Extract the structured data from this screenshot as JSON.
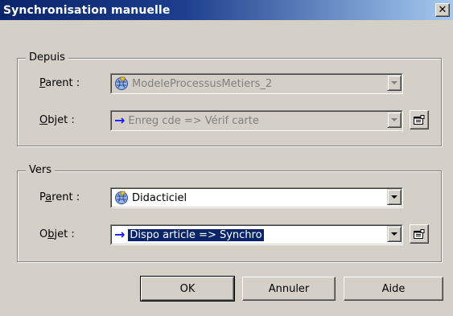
{
  "window": {
    "title": "Synchronisation manuelle",
    "close_glyph": "✕"
  },
  "from_group": {
    "legend": "Depuis",
    "parent_label_access": "P",
    "parent_label_rest": "arent :",
    "object_label_access": "O",
    "object_label_rest": "bjet :",
    "parent_value": "ModeleProcessusMetiers_2",
    "object_value": "Enreg cde => Vérif carte",
    "object_arrow": "→"
  },
  "to_group": {
    "legend": "Vers",
    "parent_label_pre": "P",
    "parent_label_access": "a",
    "parent_label_rest": "rent :",
    "object_label_pre": "O",
    "object_label_access": "b",
    "object_label_rest": "jet :",
    "parent_value": "Didacticiel",
    "object_value": "Dispo article => Synchro",
    "object_arrow": "→"
  },
  "buttons": {
    "ok": "OK",
    "cancel": "Annuler",
    "help": "Aide"
  },
  "icons": {
    "model": "model-icon",
    "arrow": "arrow-icon",
    "properties": "properties-icon",
    "dropdown": "chevron-down-icon"
  }
}
